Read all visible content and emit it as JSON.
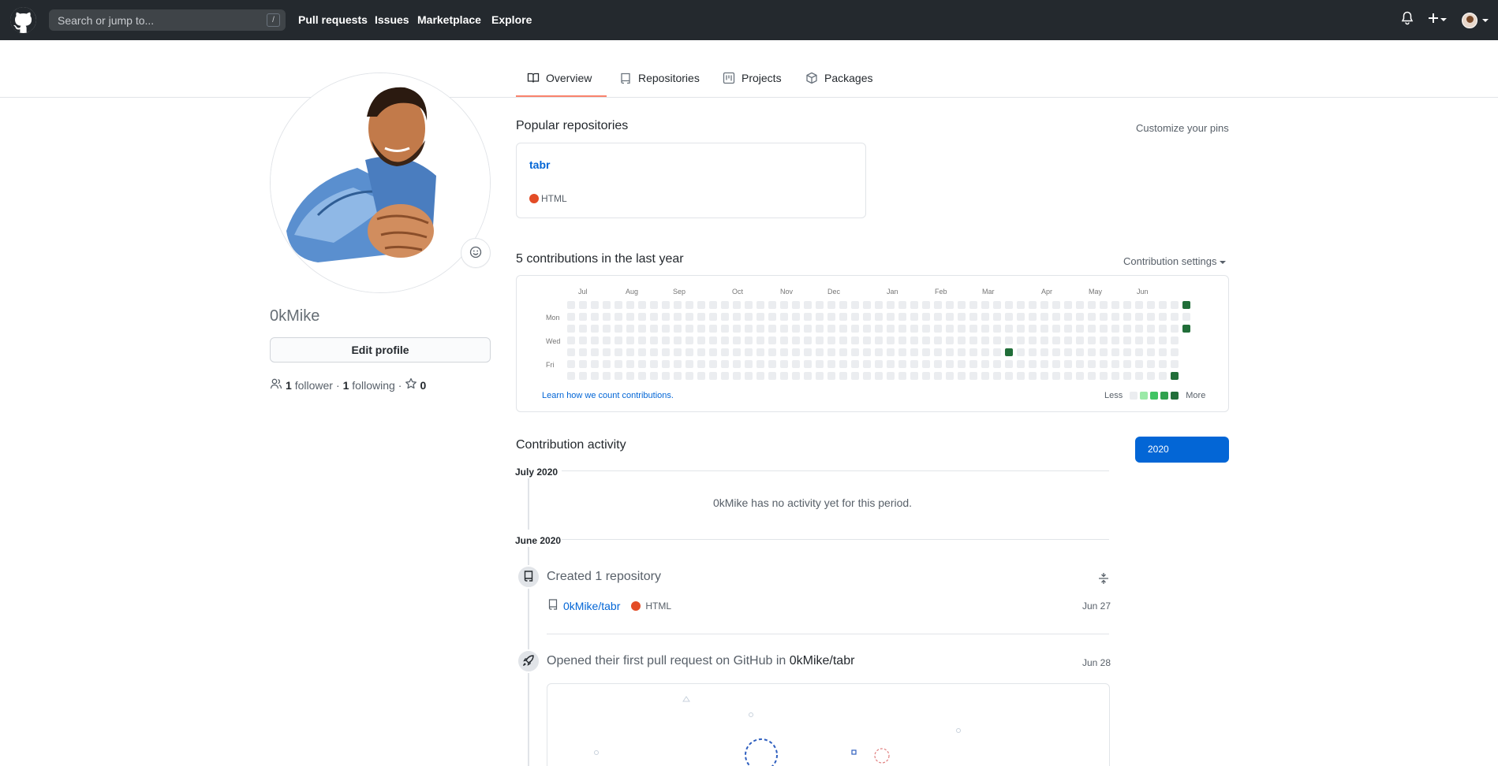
{
  "header": {
    "search_placeholder": "Search or jump to...",
    "search_key": "/",
    "nav": [
      "Pull requests",
      "Issues",
      "Marketplace",
      "Explore"
    ],
    "icons": [
      "github-logo-icon",
      "bell-icon",
      "plus-icon",
      "avatar-icon"
    ]
  },
  "tabs": [
    {
      "label": "Overview",
      "icon": "book-icon",
      "active": true
    },
    {
      "label": "Repositories",
      "icon": "repo-icon",
      "active": false
    },
    {
      "label": "Projects",
      "icon": "project-icon",
      "active": false
    },
    {
      "label": "Packages",
      "icon": "package-icon",
      "active": false
    }
  ],
  "profile": {
    "username": "0kMike",
    "edit_label": "Edit profile",
    "followers_count": "1",
    "followers_label": "follower",
    "separator": "·",
    "following_count": "1",
    "following_label": "following",
    "stars_count": "0"
  },
  "popular": {
    "title": "Popular repositories",
    "customize": "Customize your pins",
    "repos": [
      {
        "name": "tabr",
        "language": "HTML",
        "language_color": "#e34c26"
      }
    ]
  },
  "contributions": {
    "title": "5 contributions in the last year",
    "settings": "Contribution settings",
    "months": [
      "Jul",
      "Aug",
      "Sep",
      "Oct",
      "Nov",
      "Dec",
      "Jan",
      "Feb",
      "Mar",
      "Apr",
      "May",
      "Jun"
    ],
    "days": [
      "Mon",
      "Wed",
      "Fri"
    ],
    "learn": "Learn how we count contributions.",
    "less": "Less",
    "more": "More",
    "level_colors": [
      "#ebedf0",
      "#9be9a8",
      "#40c463",
      "#30a14e",
      "#216e39"
    ],
    "weeks": 53,
    "active_cells": [
      {
        "week": 52,
        "day": 0,
        "level": 4
      },
      {
        "week": 52,
        "day": 2,
        "level": 4
      },
      {
        "week": 37,
        "day": 4,
        "level": 4
      },
      {
        "week": 51,
        "day": 6,
        "level": 4
      }
    ]
  },
  "activity": {
    "title": "Contribution activity",
    "year": "2020",
    "months": [
      {
        "label": "July 2020",
        "empty_text": "0kMike has no activity yet for this period."
      },
      {
        "label": "June 2020"
      }
    ],
    "created": {
      "title": "Created 1 repository",
      "repo": "0kMike/tabr",
      "language": "HTML",
      "date": "Jun 27"
    },
    "pr": {
      "title_prefix": "Opened their first pull request on GitHub in",
      "repo": "0kMike/tabr",
      "date": "Jun 28"
    }
  }
}
